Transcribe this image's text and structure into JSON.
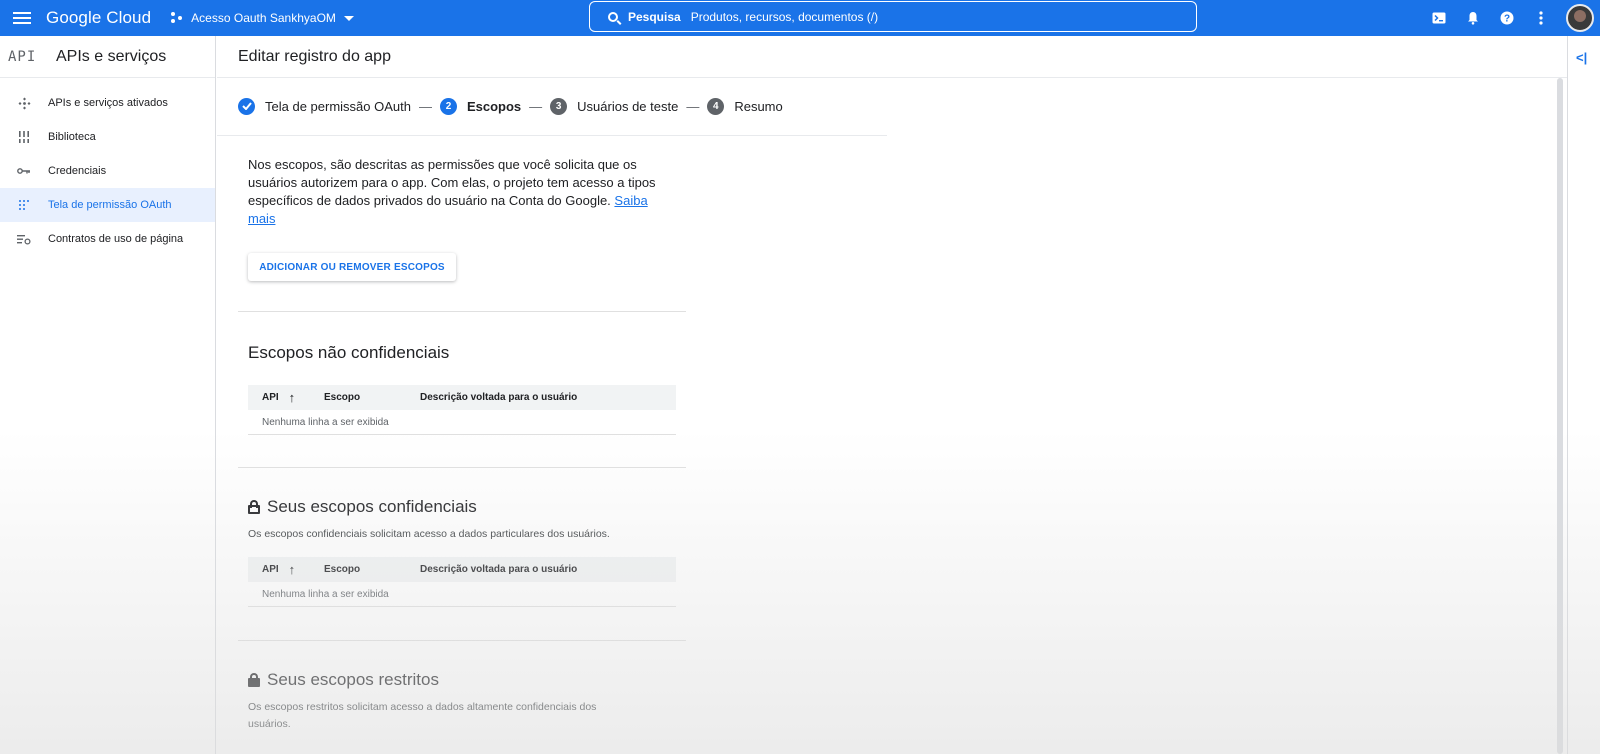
{
  "topbar": {
    "brand": "Google Cloud",
    "project": "Acesso Oauth SankhyaOM",
    "search_label": "Pesquisa",
    "search_placeholder": "Produtos, recursos, documentos (/)",
    "accent": "#1a73e8"
  },
  "sidebar": {
    "logo": "API",
    "title": "APIs e serviços",
    "items": [
      {
        "label": "APIs e serviços ativados",
        "icon": "api-diamond-icon"
      },
      {
        "label": "Biblioteca",
        "icon": "library-icon"
      },
      {
        "label": "Credenciais",
        "icon": "key-icon"
      },
      {
        "label": "Tela de permissão OAuth",
        "icon": "oauth-consent-icon",
        "active": true
      },
      {
        "label": "Contratos de uso de página",
        "icon": "page-usage-icon"
      }
    ]
  },
  "main": {
    "title": "Editar registro do app",
    "steps": [
      {
        "num": "✓",
        "label": "Tela de permissão OAuth",
        "state": "done"
      },
      {
        "num": "2",
        "label": "Escopos",
        "state": "current"
      },
      {
        "num": "3",
        "label": "Usuários de teste",
        "state": "todo"
      },
      {
        "num": "4",
        "label": "Resumo",
        "state": "todo"
      }
    ],
    "description": "Nos escopos, são descritas as permissões que você solicita que os usuários autorizem para o app. Com elas, o projeto tem acesso a tipos específicos de dados privados do usuário na Conta do Google.",
    "learn_more": "Saiba mais",
    "add_button": "ADICIONAR OU REMOVER ESCOPOS",
    "sections": {
      "non_sensitive": {
        "title": "Escopos não confidenciais",
        "columns": [
          "API",
          "Escopo",
          "Descrição voltada para o usuário"
        ],
        "empty": "Nenhuma linha a ser exibida"
      },
      "sensitive": {
        "title": "Seus escopos confidenciais",
        "subtitle": "Os escopos confidenciais solicitam acesso a dados particulares dos usuários.",
        "columns": [
          "API",
          "Escopo",
          "Descrição voltada para o usuário"
        ],
        "empty": "Nenhuma linha a ser exibida"
      },
      "restricted": {
        "title": "Seus escopos restritos",
        "subtitle": "Os escopos restritos solicitam acesso a dados altamente confidenciais dos usuários."
      }
    }
  }
}
